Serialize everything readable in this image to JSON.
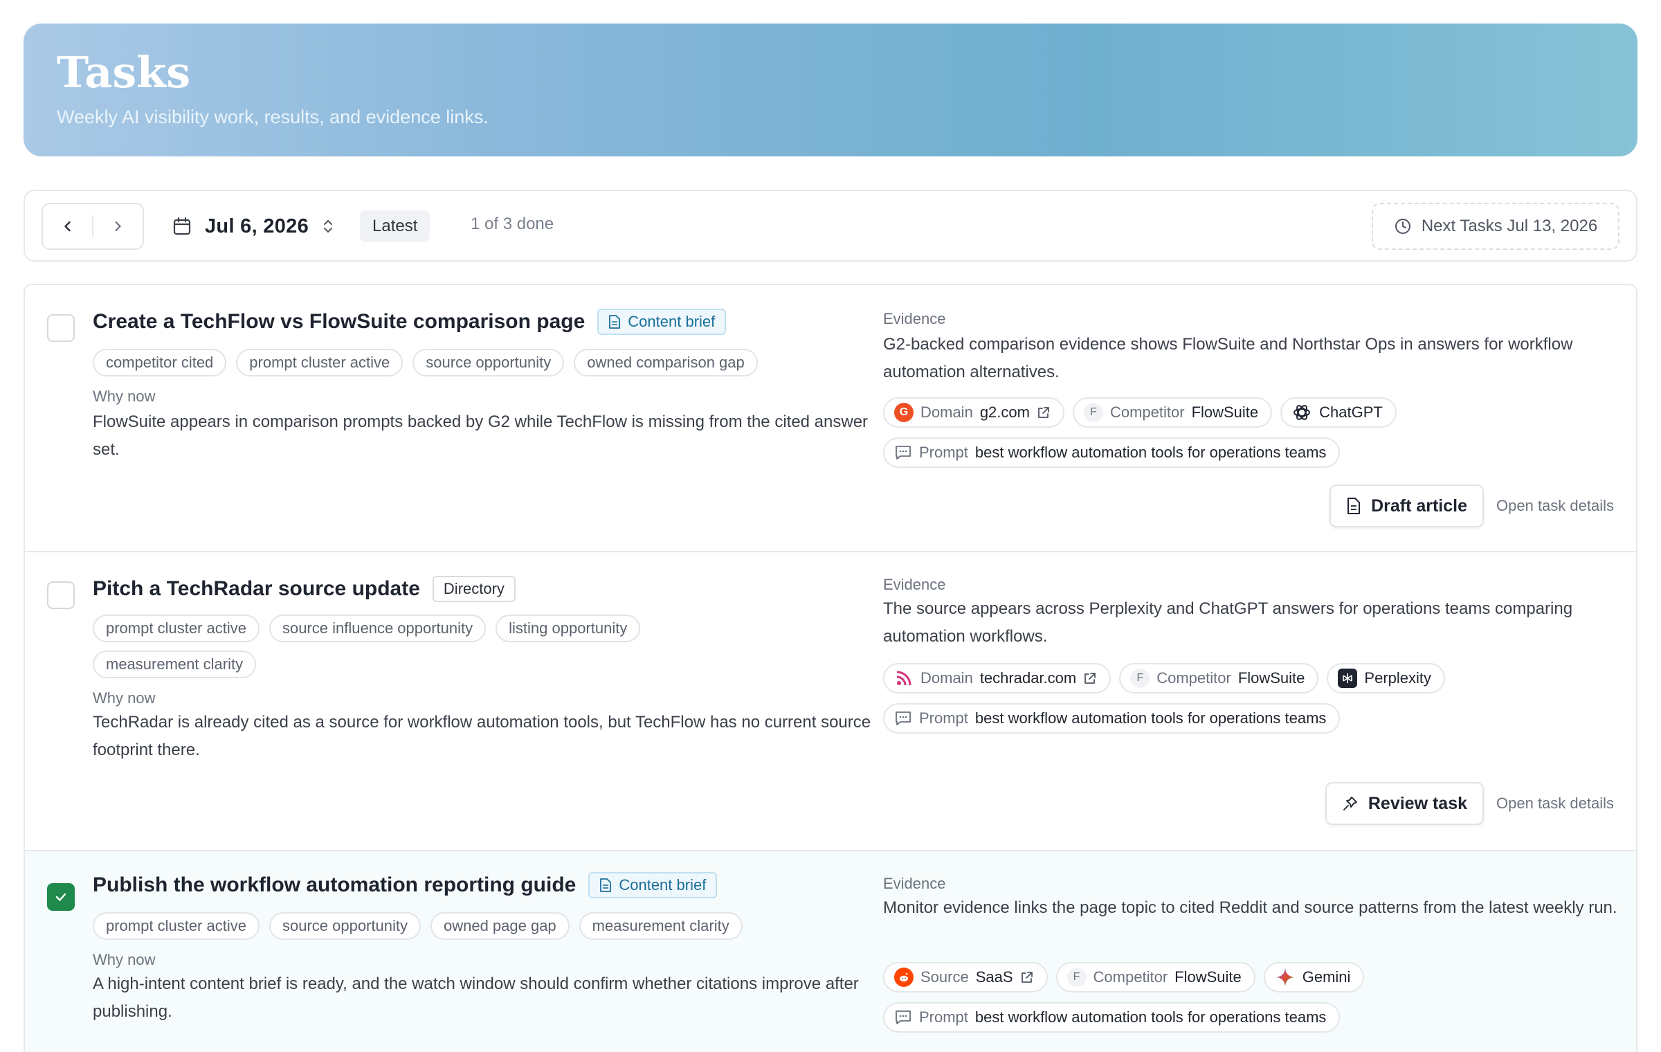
{
  "header": {
    "title": "Tasks",
    "subtitle": "Weekly AI visibility work, results, and evidence links."
  },
  "toolbar": {
    "date": "Jul 6, 2026",
    "latest": "Latest",
    "progress": "1 of 3 done",
    "next_tasks": "Next Tasks Jul 13, 2026"
  },
  "tasks": [
    {
      "title": "Create a TechFlow vs FlowSuite comparison page",
      "type": "Content brief",
      "done": false,
      "tags": [
        "competitor cited",
        "prompt cluster active",
        "source opportunity",
        "owned comparison gap"
      ],
      "why_label": "Why now",
      "why": "FlowSuite appears in comparison prompts backed by G2 while TechFlow is missing from the cited answer set.",
      "evidence_label": "Evidence",
      "evidence": "G2-backed comparison evidence shows FlowSuite and Northstar Ops in answers for workflow automation alternatives.",
      "chips": {
        "domain_label": "Domain",
        "domain_value": "g2.com",
        "competitor_label": "Competitor",
        "competitor_value": "FlowSuite",
        "competitor_letter": "F",
        "engine": "ChatGPT",
        "prompt_label": "Prompt",
        "prompt_value": "best workflow automation tools for operations teams"
      },
      "primary_action": "Draft article",
      "secondary_action": "Open task details"
    },
    {
      "title": "Pitch a TechRadar source update",
      "type": "Directory",
      "done": false,
      "tags": [
        "prompt cluster active",
        "source influence opportunity",
        "listing opportunity",
        "measurement clarity"
      ],
      "why_label": "Why now",
      "why": "TechRadar is already cited as a source for workflow automation tools, but TechFlow has no current source footprint there.",
      "evidence_label": "Evidence",
      "evidence": "The source appears across Perplexity and ChatGPT answers for operations teams comparing automation workflows.",
      "chips": {
        "domain_label": "Domain",
        "domain_value": "techradar.com",
        "competitor_label": "Competitor",
        "competitor_value": "FlowSuite",
        "competitor_letter": "F",
        "engine": "Perplexity",
        "prompt_label": "Prompt",
        "prompt_value": "best workflow automation tools for operations teams"
      },
      "primary_action": "Review task",
      "secondary_action": "Open task details"
    },
    {
      "title": "Publish the workflow automation reporting guide",
      "type": "Content brief",
      "done": true,
      "tags": [
        "prompt cluster active",
        "source opportunity",
        "owned page gap",
        "measurement clarity"
      ],
      "why_label": "Why now",
      "why": "A high-intent content brief is ready, and the watch window should confirm whether citations improve after publishing.",
      "evidence_label": "Evidence",
      "evidence": "Monitor evidence links the page topic to cited Reddit and source patterns from the latest weekly run.",
      "chips": {
        "domain_label": "Source",
        "domain_value": "SaaS",
        "competitor_label": "Competitor",
        "competitor_value": "FlowSuite",
        "competitor_letter": "F",
        "engine": "Gemini",
        "prompt_label": "Prompt",
        "prompt_value": "best workflow automation tools for operations teams"
      }
    }
  ]
}
